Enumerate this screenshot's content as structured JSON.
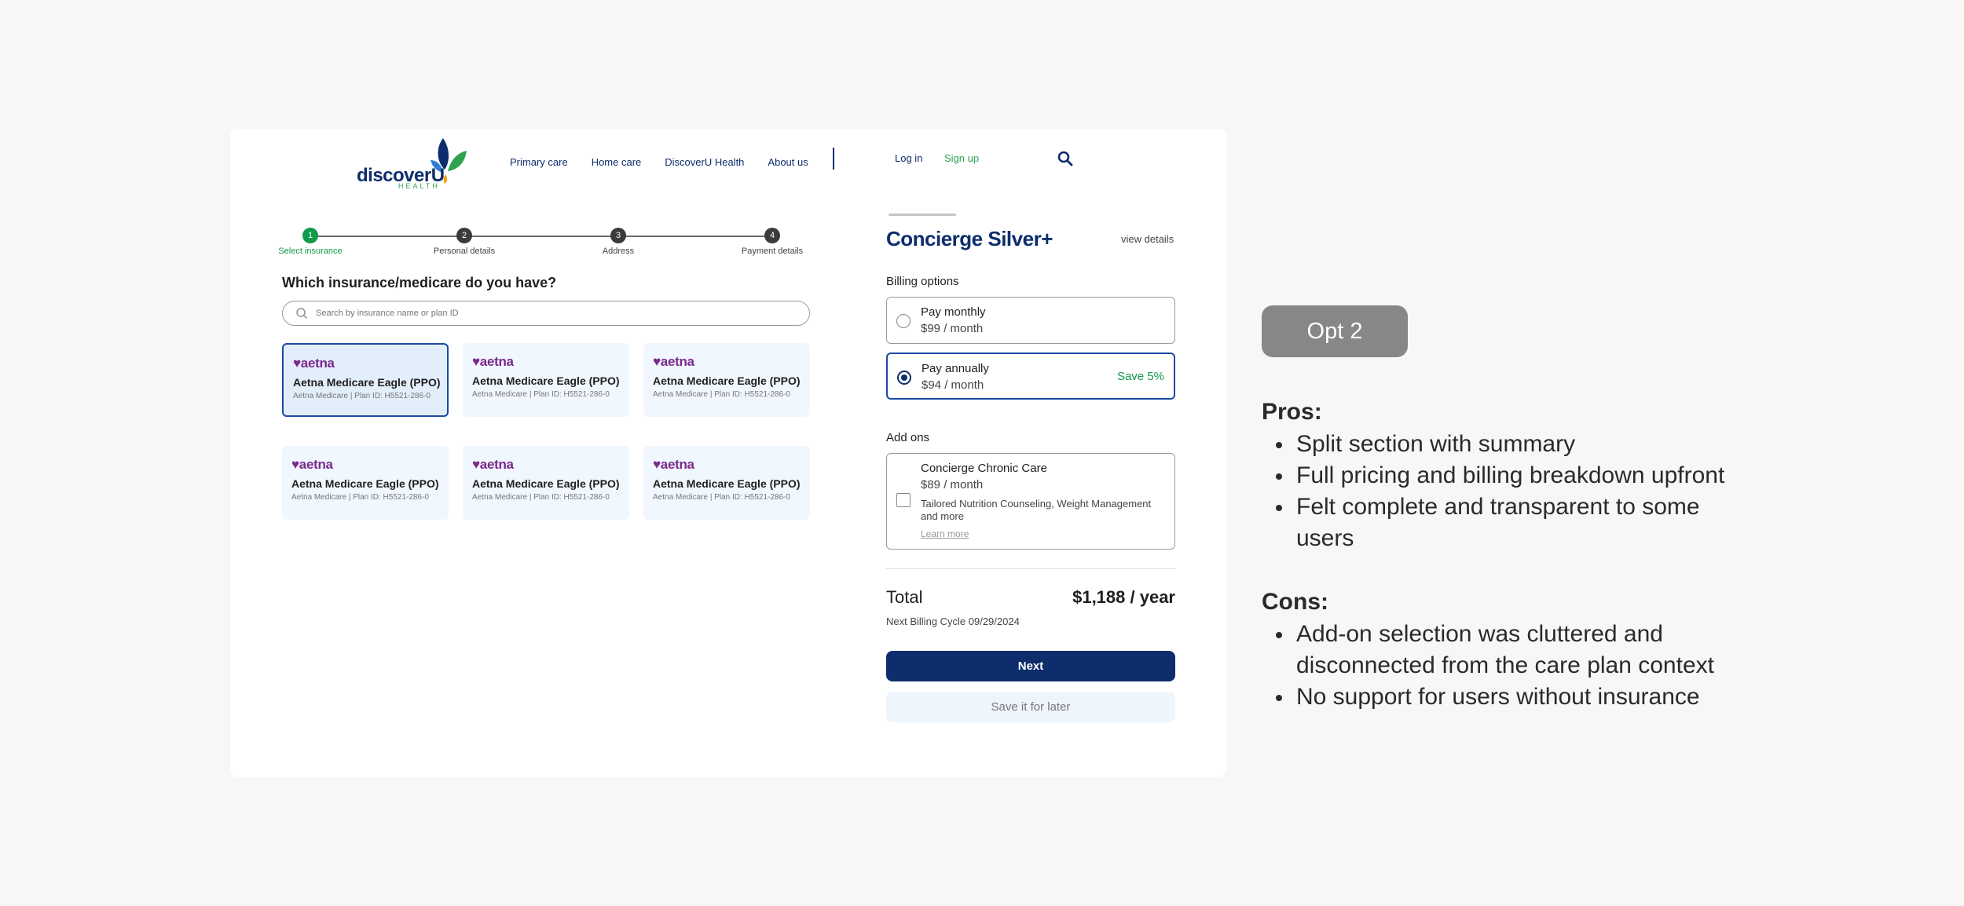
{
  "brand": {
    "logo_text": "discoverU",
    "logo_subtext": "HEALTH"
  },
  "nav": {
    "links": [
      "Primary care",
      "Home care",
      "DiscoverU Health",
      "About us"
    ],
    "login": "Log in",
    "signup": "Sign up"
  },
  "stepper": {
    "steps": [
      {
        "num": "1",
        "label": "Select insurance"
      },
      {
        "num": "2",
        "label": "Personal details"
      },
      {
        "num": "3",
        "label": "Address"
      },
      {
        "num": "4",
        "label": "Payment details"
      }
    ],
    "active": 1
  },
  "insurance": {
    "question": "Which insurance/medicare do you have?",
    "search_placeholder": "Search by insurance name or plan ID",
    "cards": [
      {
        "brand": "♥aetna",
        "name": "Aetna Medicare Eagle (PPO)",
        "sub": "Aetna Medicare | Plan ID: H5521-286-0"
      },
      {
        "brand": "♥aetna",
        "name": "Aetna Medicare Eagle (PPO)",
        "sub": "Aetna Medicare | Plan ID: H5521-286-0"
      },
      {
        "brand": "♥aetna",
        "name": "Aetna Medicare Eagle (PPO)",
        "sub": "Aetna Medicare | Plan ID: H5521-286-0"
      },
      {
        "brand": "♥aetna",
        "name": "Aetna Medicare Eagle (PPO)",
        "sub": "Aetna Medicare | Plan ID: H5521-286-0"
      },
      {
        "brand": "♥aetna",
        "name": "Aetna Medicare Eagle (PPO)",
        "sub": "Aetna Medicare | Plan ID: H5521-286-0"
      },
      {
        "brand": "♥aetna",
        "name": "Aetna Medicare Eagle (PPO)",
        "sub": "Aetna Medicare | Plan ID: H5521-286-0"
      }
    ]
  },
  "summary": {
    "plan_title": "Concierge Silver+",
    "view_details": "view details",
    "billing_label": "Billing options",
    "billing": [
      {
        "title": "Pay monthly",
        "price": "$99 / month",
        "badge": ""
      },
      {
        "title": "Pay annually",
        "price": "$94 / month",
        "badge": "Save 5%"
      }
    ],
    "addons_label": "Add ons",
    "addon": {
      "title": "Concierge Chronic Care",
      "price": "$89 / month",
      "desc": "Tailored Nutrition Counseling, Weight Management and more",
      "learn": "Learn more"
    },
    "total_label": "Total",
    "total_value": "$1,188 / year",
    "next_cycle": "Next Billing Cycle 09/29/2024",
    "next_btn": "Next",
    "later_btn": "Save it for later"
  },
  "commentary": {
    "badge": "Opt 2",
    "pros_title": "Pros:",
    "pros": [
      "Split section with summary",
      "Full pricing and billing breakdown upfront",
      "Felt complete and transparent to some users"
    ],
    "cons_title": "Cons:",
    "cons": [
      "Add-on selection was cluttered and disconnected from the care plan context",
      "No support for users without insurance"
    ]
  },
  "colors": {
    "navy": "#0d2d6c",
    "green": "#0f9a4c",
    "aetna": "#7a2a8a"
  }
}
